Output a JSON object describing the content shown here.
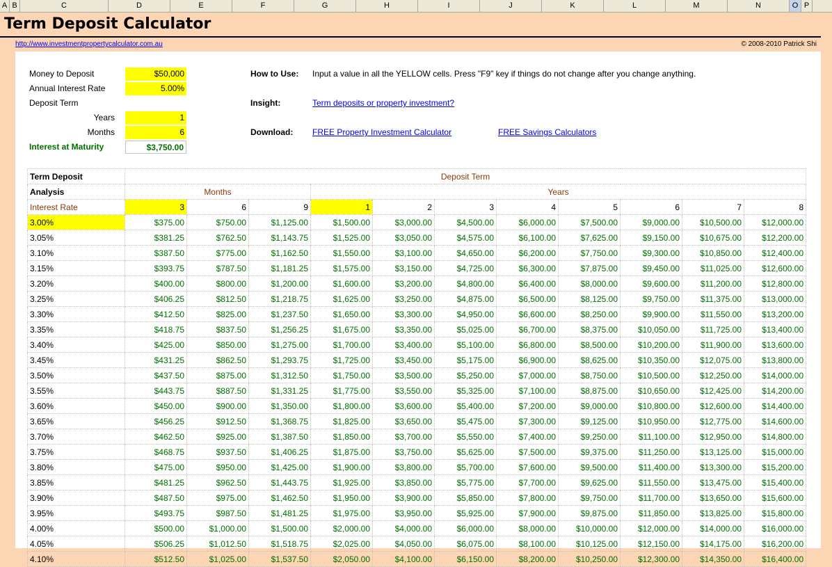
{
  "columns": [
    "A",
    "B",
    "C",
    "D",
    "E",
    "F",
    "G",
    "H",
    "I",
    "J",
    "K",
    "L",
    "M",
    "N",
    "O",
    "P"
  ],
  "title": "Term Deposit Calculator",
  "site_link": "http://www.investmentpropertycalculator.com.au",
  "copyright": "© 2008-2010 Patrick Shi",
  "inputs": {
    "money_label": "Money to Deposit",
    "money_value": "$50,000",
    "rate_label": "Annual Interest Rate",
    "rate_value": "5.00%",
    "term_label": "Deposit Term",
    "years_label": "Years",
    "years_value": "1",
    "months_label": "Months",
    "months_value": "6",
    "maturity_label": "Interest at Maturity",
    "maturity_value": "$3,750.00"
  },
  "info": {
    "how_label": "How to Use:",
    "how_text": "Input a value in all the YELLOW cells. Press \"F9\" key if things do not change after you change anything.",
    "insight_label": "Insight:",
    "insight_link": "Term deposits or property investment?",
    "download_label": "Download:",
    "download_link1": "FREE Property Investment Calculator",
    "download_link2": "FREE Savings Calculators"
  },
  "analysis": {
    "title_line1": "Term Deposit",
    "title_line2": "Analysis",
    "deposit_term": "Deposit Term",
    "months": "Months",
    "years": "Years",
    "interest_rate": "Interest Rate",
    "term_headers": [
      "3",
      "6",
      "9",
      "1",
      "2",
      "3",
      "4",
      "5",
      "6",
      "7",
      "8"
    ],
    "rows": [
      [
        "3.00%",
        "$375.00",
        "$750.00",
        "$1,125.00",
        "$1,500.00",
        "$3,000.00",
        "$4,500.00",
        "$6,000.00",
        "$7,500.00",
        "$9,000.00",
        "$10,500.00",
        "$12,000.00"
      ],
      [
        "3.05%",
        "$381.25",
        "$762.50",
        "$1,143.75",
        "$1,525.00",
        "$3,050.00",
        "$4,575.00",
        "$6,100.00",
        "$7,625.00",
        "$9,150.00",
        "$10,675.00",
        "$12,200.00"
      ],
      [
        "3.10%",
        "$387.50",
        "$775.00",
        "$1,162.50",
        "$1,550.00",
        "$3,100.00",
        "$4,650.00",
        "$6,200.00",
        "$7,750.00",
        "$9,300.00",
        "$10,850.00",
        "$12,400.00"
      ],
      [
        "3.15%",
        "$393.75",
        "$787.50",
        "$1,181.25",
        "$1,575.00",
        "$3,150.00",
        "$4,725.00",
        "$6,300.00",
        "$7,875.00",
        "$9,450.00",
        "$11,025.00",
        "$12,600.00"
      ],
      [
        "3.20%",
        "$400.00",
        "$800.00",
        "$1,200.00",
        "$1,600.00",
        "$3,200.00",
        "$4,800.00",
        "$6,400.00",
        "$8,000.00",
        "$9,600.00",
        "$11,200.00",
        "$12,800.00"
      ],
      [
        "3.25%",
        "$406.25",
        "$812.50",
        "$1,218.75",
        "$1,625.00",
        "$3,250.00",
        "$4,875.00",
        "$6,500.00",
        "$8,125.00",
        "$9,750.00",
        "$11,375.00",
        "$13,000.00"
      ],
      [
        "3.30%",
        "$412.50",
        "$825.00",
        "$1,237.50",
        "$1,650.00",
        "$3,300.00",
        "$4,950.00",
        "$6,600.00",
        "$8,250.00",
        "$9,900.00",
        "$11,550.00",
        "$13,200.00"
      ],
      [
        "3.35%",
        "$418.75",
        "$837.50",
        "$1,256.25",
        "$1,675.00",
        "$3,350.00",
        "$5,025.00",
        "$6,700.00",
        "$8,375.00",
        "$10,050.00",
        "$11,725.00",
        "$13,400.00"
      ],
      [
        "3.40%",
        "$425.00",
        "$850.00",
        "$1,275.00",
        "$1,700.00",
        "$3,400.00",
        "$5,100.00",
        "$6,800.00",
        "$8,500.00",
        "$10,200.00",
        "$11,900.00",
        "$13,600.00"
      ],
      [
        "3.45%",
        "$431.25",
        "$862.50",
        "$1,293.75",
        "$1,725.00",
        "$3,450.00",
        "$5,175.00",
        "$6,900.00",
        "$8,625.00",
        "$10,350.00",
        "$12,075.00",
        "$13,800.00"
      ],
      [
        "3.50%",
        "$437.50",
        "$875.00",
        "$1,312.50",
        "$1,750.00",
        "$3,500.00",
        "$5,250.00",
        "$7,000.00",
        "$8,750.00",
        "$10,500.00",
        "$12,250.00",
        "$14,000.00"
      ],
      [
        "3.55%",
        "$443.75",
        "$887.50",
        "$1,331.25",
        "$1,775.00",
        "$3,550.00",
        "$5,325.00",
        "$7,100.00",
        "$8,875.00",
        "$10,650.00",
        "$12,425.00",
        "$14,200.00"
      ],
      [
        "3.60%",
        "$450.00",
        "$900.00",
        "$1,350.00",
        "$1,800.00",
        "$3,600.00",
        "$5,400.00",
        "$7,200.00",
        "$9,000.00",
        "$10,800.00",
        "$12,600.00",
        "$14,400.00"
      ],
      [
        "3.65%",
        "$456.25",
        "$912.50",
        "$1,368.75",
        "$1,825.00",
        "$3,650.00",
        "$5,475.00",
        "$7,300.00",
        "$9,125.00",
        "$10,950.00",
        "$12,775.00",
        "$14,600.00"
      ],
      [
        "3.70%",
        "$462.50",
        "$925.00",
        "$1,387.50",
        "$1,850.00",
        "$3,700.00",
        "$5,550.00",
        "$7,400.00",
        "$9,250.00",
        "$11,100.00",
        "$12,950.00",
        "$14,800.00"
      ],
      [
        "3.75%",
        "$468.75",
        "$937.50",
        "$1,406.25",
        "$1,875.00",
        "$3,750.00",
        "$5,625.00",
        "$7,500.00",
        "$9,375.00",
        "$11,250.00",
        "$13,125.00",
        "$15,000.00"
      ],
      [
        "3.80%",
        "$475.00",
        "$950.00",
        "$1,425.00",
        "$1,900.00",
        "$3,800.00",
        "$5,700.00",
        "$7,600.00",
        "$9,500.00",
        "$11,400.00",
        "$13,300.00",
        "$15,200.00"
      ],
      [
        "3.85%",
        "$481.25",
        "$962.50",
        "$1,443.75",
        "$1,925.00",
        "$3,850.00",
        "$5,775.00",
        "$7,700.00",
        "$9,625.00",
        "$11,550.00",
        "$13,475.00",
        "$15,400.00"
      ],
      [
        "3.90%",
        "$487.50",
        "$975.00",
        "$1,462.50",
        "$1,950.00",
        "$3,900.00",
        "$5,850.00",
        "$7,800.00",
        "$9,750.00",
        "$11,700.00",
        "$13,650.00",
        "$15,600.00"
      ],
      [
        "3.95%",
        "$493.75",
        "$987.50",
        "$1,481.25",
        "$1,975.00",
        "$3,950.00",
        "$5,925.00",
        "$7,900.00",
        "$9,875.00",
        "$11,850.00",
        "$13,825.00",
        "$15,800.00"
      ],
      [
        "4.00%",
        "$500.00",
        "$1,000.00",
        "$1,500.00",
        "$2,000.00",
        "$4,000.00",
        "$6,000.00",
        "$8,000.00",
        "$10,000.00",
        "$12,000.00",
        "$14,000.00",
        "$16,000.00"
      ],
      [
        "4.05%",
        "$506.25",
        "$1,012.50",
        "$1,518.75",
        "$2,025.00",
        "$4,050.00",
        "$6,075.00",
        "$8,100.00",
        "$10,125.00",
        "$12,150.00",
        "$14,175.00",
        "$16,200.00"
      ],
      [
        "4.10%",
        "$512.50",
        "$1,025.00",
        "$1,537.50",
        "$2,050.00",
        "$4,100.00",
        "$6,150.00",
        "$8,200.00",
        "$10,250.00",
        "$12,300.00",
        "$14,350.00",
        "$16,400.00"
      ]
    ]
  },
  "colors": {
    "yellow": "#ffff00",
    "green": "#007000",
    "brown": "#8b3a0a",
    "background": "#fcd5b4"
  }
}
